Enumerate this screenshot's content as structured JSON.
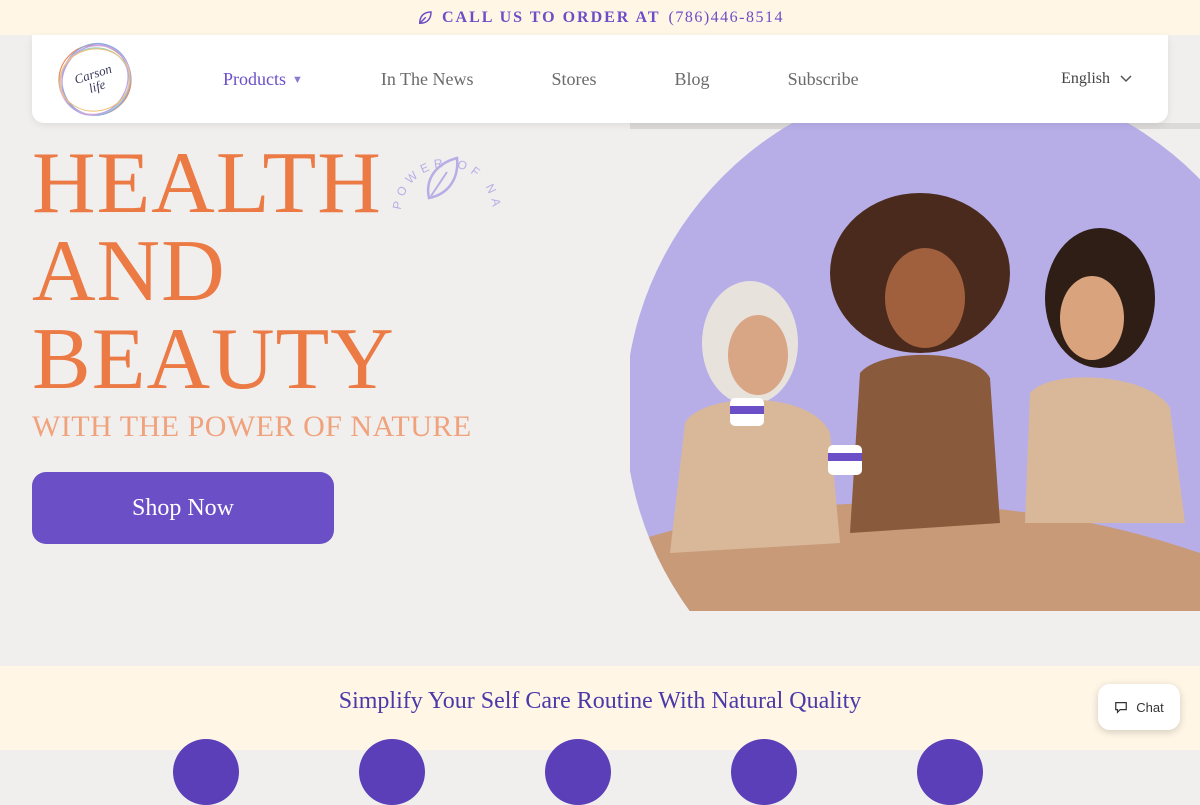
{
  "topbar": {
    "label": "CALL US TO ORDER AT",
    "phone": "(786)446-8514",
    "icon": "leaf-icon"
  },
  "logo": {
    "line1": "Carson",
    "line2": "life"
  },
  "nav": {
    "items": [
      {
        "label": "Products",
        "active": true,
        "has_dropdown": true
      },
      {
        "label": "In The News"
      },
      {
        "label": "Stores"
      },
      {
        "label": "Blog"
      },
      {
        "label": "Subscribe"
      }
    ],
    "language": "English"
  },
  "hero": {
    "title_lines": [
      "HEALTH",
      "AND",
      "BEAUTY"
    ],
    "subtitle": "WITH THE POWER OF NATURE",
    "cta": "Shop Now",
    "badge_text": "POWER OF NATURE",
    "image_alt": "Three women smiling holding jars of cream"
  },
  "band": {
    "title": "Simplify Your Self Care Routine With Natural Quality"
  },
  "chat": {
    "label": "Chat"
  },
  "colors": {
    "accent": "#6a4fc6",
    "orange": "#eb7a45",
    "peach": "#f0a27d",
    "cream": "#fff6e6",
    "background": "#f0efed",
    "lavender": "#b7aee8"
  }
}
